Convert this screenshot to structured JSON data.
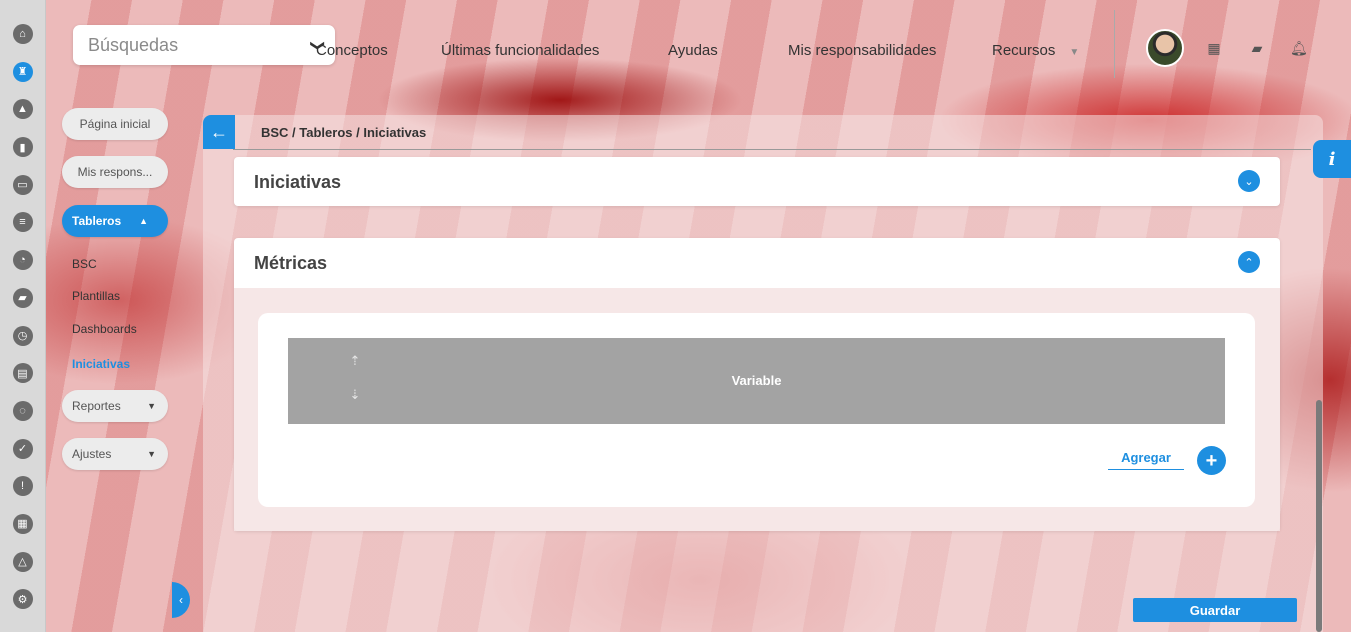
{
  "rail": {
    "icons": [
      "home-icon",
      "castle-icon",
      "warning-triangle-icon",
      "bar-chart-icon",
      "presentation-icon",
      "sliders-icon",
      "pie-chart-icon",
      "folder-icon",
      "clock-icon",
      "document-icon",
      "cycle-icon",
      "check-circle-icon",
      "alert-icon",
      "calendar-icon",
      "network-icon",
      "gear-icon"
    ],
    "glyphs": [
      "⌂",
      "♜",
      "▲",
      "▮",
      "▭",
      "≡",
      "◔",
      "▰",
      "◷",
      "▤",
      "◌",
      "✓",
      "!",
      "▦",
      "△",
      "⚙"
    ]
  },
  "topbar": {
    "search_label": "Búsquedas",
    "chevron_glyph": "❯",
    "nav": [
      "Conceptos",
      "Últimas funcionalidades",
      "Ayudas",
      "Mis responsabilidades",
      "Recursos"
    ],
    "recursos_caret": "▼"
  },
  "sidebar": {
    "home": "Página inicial",
    "responsibilities": "Mis respons...",
    "tableros": "Tableros",
    "tableros_caret": "▲",
    "sub_items": [
      "BSC",
      "Plantillas",
      "Dashboards",
      "Iniciativas"
    ],
    "reportes": "Reportes",
    "ajustes": "Ajustes",
    "drop_caret": "▼",
    "collapse_glyph": "‹"
  },
  "panel": {
    "back_glyph": "←",
    "breadcrumb": "BSC / Tableros / Iniciativas",
    "iniciativas_title": "Iniciativas",
    "metricas_title": "Métricas",
    "collapsed_glyph": "⌄",
    "expanded_glyph": "⌃",
    "table_header": "Variable",
    "upload_glyph": "⇡",
    "download_glyph": "⇣",
    "add_label": "Agregar",
    "add_glyph": "+"
  },
  "info_glyph": "i",
  "save_label": "Guardar",
  "colors": {
    "accent": "#1e8fe0",
    "table_header_bg": "#a3a3a3",
    "rail_bg": "#d9d9d9"
  }
}
